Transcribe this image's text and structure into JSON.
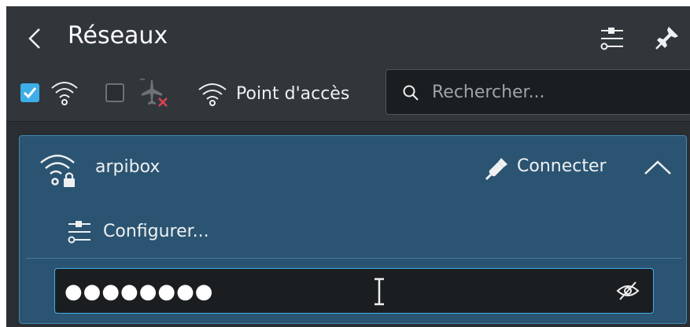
{
  "header": {
    "title": "Réseaux",
    "back_icon": "chevron-left-icon",
    "configure_icon": "configure-sliders-icon",
    "pin_icon": "pin-icon"
  },
  "toolbar": {
    "wifi_enabled": true,
    "wifi_icon": "wifi-icon",
    "airplane_mode": false,
    "airplane_icon": "airplane-disabled-icon",
    "hotspot_label": "Point d'accès",
    "search_placeholder": "Rechercher..."
  },
  "network": {
    "name": "arpibox",
    "icon": "wifi-locked-icon",
    "connect_label": "Connecter",
    "connect_icon": "plug-connect-icon",
    "expanded": true,
    "configure_label": "Configurer...",
    "password_value": "●●●●●●●●",
    "show_password_icon": "eye-hidden-icon"
  },
  "colors": {
    "accent": "#3daee9",
    "panel_bg": "#2a2e32",
    "header_bg": "#31363b",
    "selected_item_bg": "#2b5472",
    "field_bg": "#1b1e20"
  }
}
